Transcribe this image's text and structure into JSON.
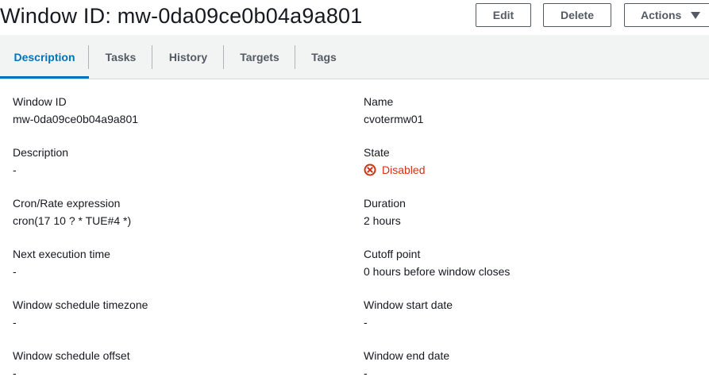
{
  "header": {
    "title": "Window ID: mw-0da09ce0b04a9a801",
    "edit_label": "Edit",
    "delete_label": "Delete",
    "actions_label": "Actions"
  },
  "tabs": [
    {
      "label": "Description",
      "active": true
    },
    {
      "label": "Tasks",
      "active": false
    },
    {
      "label": "History",
      "active": false
    },
    {
      "label": "Targets",
      "active": false
    },
    {
      "label": "Tags",
      "active": false
    }
  ],
  "details": {
    "left": [
      {
        "label": "Window ID",
        "value": "mw-0da09ce0b04a9a801"
      },
      {
        "label": "Description",
        "value": "-"
      },
      {
        "label": "Cron/Rate expression",
        "value": "cron(17 10 ? * TUE#4 *)"
      },
      {
        "label": "Next execution time",
        "value": "-"
      },
      {
        "label": "Window schedule timezone",
        "value": "-"
      },
      {
        "label": "Window schedule offset",
        "value": "-"
      }
    ],
    "right": [
      {
        "label": "Name",
        "value": "cvotermw01"
      },
      {
        "label": "State",
        "value": "Disabled",
        "icon": "error-circle-icon",
        "color": "#d13212"
      },
      {
        "label": "Duration",
        "value": "2 hours"
      },
      {
        "label": "Cutoff point",
        "value": "0 hours before window closes"
      },
      {
        "label": "Window start date",
        "value": "-"
      },
      {
        "label": "Window end date",
        "value": "-"
      }
    ]
  },
  "colors": {
    "accent": "#0073bb",
    "error": "#d13212",
    "text": "#16191f",
    "muted": "#545b64"
  }
}
